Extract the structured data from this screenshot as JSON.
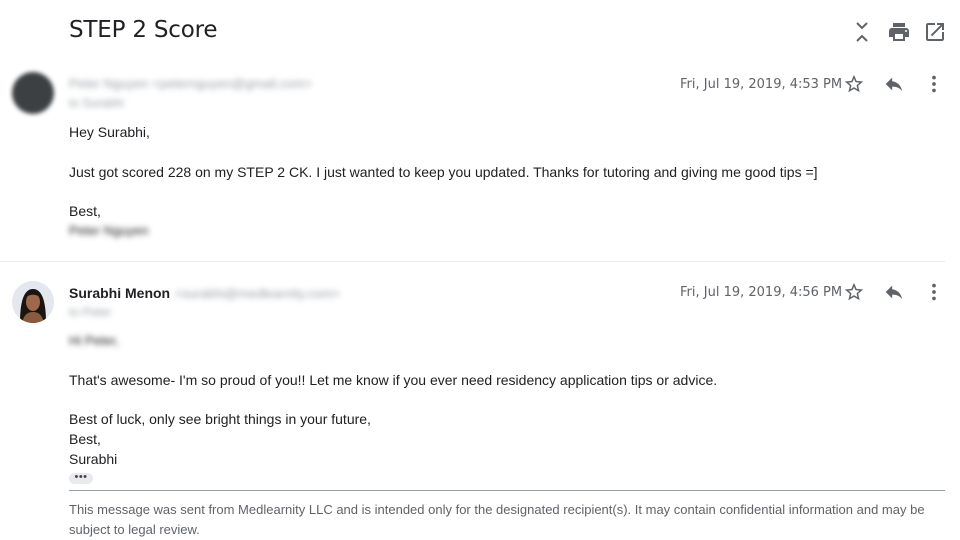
{
  "email": {
    "subject": "STEP 2 Score",
    "toolbar": {
      "collapse_icon": "collapse-icon",
      "print_icon": "print-icon",
      "open_new_window_icon": "open-in-new-icon"
    },
    "messages": [
      {
        "sender_name": "Peter Nguyen",
        "sender_email": "<peternguyen@gmail.com>",
        "to_line": "to Surabhi",
        "date": "Fri, Jul 19, 2019, 4:53 PM",
        "body": [
          "Hey Surabhi,",
          "Just got scored 228 on my STEP 2 CK. I just wanted to keep you updated. Thanks for tutoring and giving me good tips =]",
          "Best,",
          "Peter Nguyen"
        ]
      },
      {
        "sender_name": "Surabhi Menon",
        "sender_email": "<surabhi@medlearnity.com>",
        "to_line": "to Peter",
        "date": "Fri, Jul 19, 2019, 4:56 PM",
        "body": [
          "Hi Peter,",
          "That's awesome- I'm so proud of you!! Let me know if you ever need residency application tips or advice.",
          "Best of luck, only see bright things in your future,",
          "Best,",
          "Surabhi"
        ],
        "trimmed_content": "•••",
        "footer": "This message was sent from Medlearnity LLC and is intended only for the designated recipient(s). It may contain confidential information and may be subject to legal review."
      }
    ]
  },
  "colors": {
    "text": "#202124",
    "muted": "#5f6368",
    "divider": "#e8eaed"
  }
}
